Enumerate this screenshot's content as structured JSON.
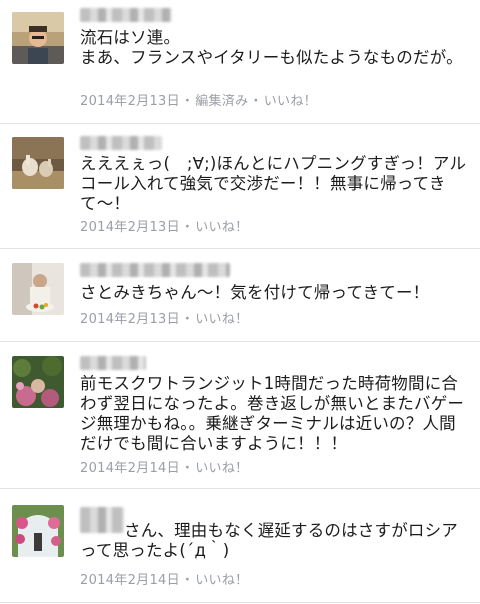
{
  "comments": [
    {
      "text": "流石はソ連。\nまあ、フランスやイタリーも似たようなものだが。",
      "date": "2014年2月13日",
      "edited": "編集済み",
      "like": "いいね！",
      "sep": "・"
    },
    {
      "text": "えええぇっ(　;∀;)ほんとにハプニングすぎっ！アルコール入れて強気で交渉だー！！無事に帰ってきて〜！",
      "date": "2014年2月13日",
      "like": "いいね！",
      "sep": "・"
    },
    {
      "text": "さとみきちゃん〜！気を付けて帰ってきてー！",
      "date": "2014年2月13日",
      "like": "いいね！",
      "sep": "・"
    },
    {
      "text": "前モスクワトランジット1時間だった時荷物間に合わず翌日になったよ。巻き返しが無いとまたバゲージ無理かもね。。乗継ぎターミナルは近いの？人間だけでも間に合いますように！！！",
      "date": "2014年2月14日",
      "like": "いいね！",
      "sep": "・"
    },
    {
      "text": "さん、理由もなく遅延するのはさすがロシアって思ったよ(´д｀)",
      "date": "2014年2月14日",
      "like": "いいね！",
      "sep": "・"
    }
  ],
  "colors": {
    "meta": "#9a9ea5",
    "text": "#1c1c1c",
    "divider": "#e3e3e3"
  }
}
